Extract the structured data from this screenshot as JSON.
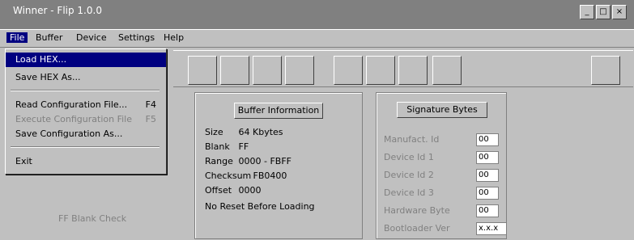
{
  "window": {
    "title": "Winner - Flip 1.0.0",
    "controls": [
      "_",
      "□",
      "×"
    ]
  },
  "menubar": {
    "items": [
      "File",
      "Buffer",
      "Device",
      "Settings",
      "Help"
    ]
  },
  "file_menu": {
    "items": [
      {
        "label": "Load HEX...",
        "shortcut": ""
      },
      {
        "label": "Save HEX As...",
        "shortcut": ""
      },
      {
        "label": "Read Configuration File...",
        "shortcut": "F4"
      },
      {
        "label": "Execute Configuration File",
        "shortcut": "F5"
      },
      {
        "label": "Save Configuration As...",
        "shortcut": ""
      },
      {
        "label": "Exit",
        "shortcut": ""
      }
    ]
  },
  "buffer_panel": {
    "button": "Buffer Information",
    "size_label": "Size",
    "size_value": "64 Kbytes",
    "blank_label": "Blank",
    "blank_value": "FF",
    "range_label": "Range",
    "range_value": "0000 - FBFF",
    "checksum_label": "Checksum",
    "checksum_value": "FB0400",
    "offset_label": "Offset",
    "offset_value": "0000",
    "note": "No Reset Before Loading"
  },
  "left_panel": {
    "status": "FF Blank Check"
  },
  "protection_panel": {
    "button": "Signature Bytes",
    "fields": [
      {
        "label": "Manufact. Id",
        "value": "00"
      },
      {
        "label": "Device Id 1",
        "value": "00"
      },
      {
        "label": "Device Id 2",
        "value": "00"
      },
      {
        "label": "Device Id 3",
        "value": "00"
      },
      {
        "label": "Hardware Byte",
        "value": "00"
      },
      {
        "label": "Bootloader Ver",
        "value": "x.x.x"
      }
    ]
  },
  "icons": [
    "chip-icon",
    "erase-icon",
    "blank-check-icon",
    "program-icon",
    "verify-icon",
    "run-icon",
    "config-icon",
    "settings-icon",
    "help-icon"
  ]
}
